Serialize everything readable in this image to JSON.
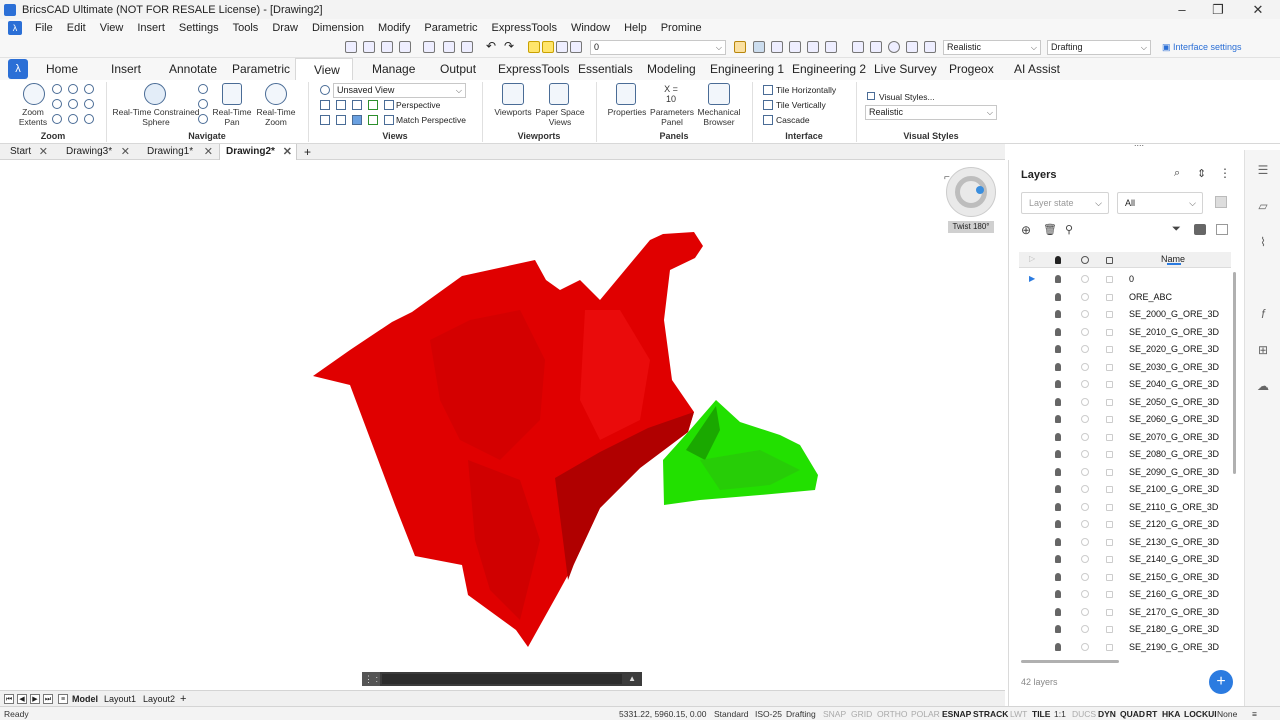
{
  "window": {
    "title": "BricsCAD Ultimate (NOT FOR RESALE License) - [Drawing2]"
  },
  "menu": [
    "File",
    "Edit",
    "View",
    "Insert",
    "Settings",
    "Tools",
    "Draw",
    "Dimension",
    "Modify",
    "Parametric",
    "ExpressTools",
    "Window",
    "Help",
    "Promine"
  ],
  "qat": {
    "layer_combo": "0",
    "visual_style": "Realistic",
    "workspace": "Drafting",
    "interface_settings": "Interface settings"
  },
  "ribbon_tabs": [
    "Home",
    "Insert",
    "Annotate",
    "Parametric",
    "View",
    "Manage",
    "Output",
    "ExpressTools",
    "Essentials",
    "Modeling",
    "Engineering 1",
    "Engineering 2",
    "Live Survey",
    "Progeox",
    "AI Assist"
  ],
  "ribbon": {
    "zoom": {
      "title": "Zoom",
      "zoom_extents": "Zoom Extents"
    },
    "navigate": {
      "title": "Navigate",
      "constrained_sphere": "Real-Time Constrained Sphere",
      "pan": "Real-Time Pan",
      "zoom": "Real-Time Zoom"
    },
    "views": {
      "title": "Views",
      "view_combo": "Unsaved View",
      "perspective": "Perspective",
      "match_perspective": "Match Perspective"
    },
    "viewports": {
      "title": "Viewports",
      "viewports": "Viewports",
      "paper_space": "Paper Space Views"
    },
    "panels": {
      "title": "Panels",
      "properties": "Properties",
      "parameters": "Parameters Panel",
      "mechanical": "Mechanical Browser",
      "param_glyph": "X = 10"
    },
    "interface": {
      "title": "Interface",
      "tile_h": "Tile Horizontally",
      "tile_v": "Tile Vertically",
      "cascade": "Cascade"
    },
    "visual_styles": {
      "title": "Visual Styles",
      "link": "Visual Styles...",
      "combo": "Realistic"
    }
  },
  "doc_tabs": [
    "Start",
    "Drawing3*",
    "Drawing1*",
    "Drawing2*"
  ],
  "viewport": {
    "twist": "Twist 180°",
    "colors": {
      "red_body": "#e00000",
      "red_dark": "#b00000",
      "green_body": "#22e000",
      "green_dark": "#1aa800"
    }
  },
  "layout_tabs": [
    "Model",
    "Layout1",
    "Layout2"
  ],
  "status": {
    "ready": "Ready",
    "coords": "5331.22, 5960.15, 0.00",
    "items": [
      {
        "label": "Standard",
        "state": "plain"
      },
      {
        "label": "ISO-25",
        "state": "plain"
      },
      {
        "label": "Drafting",
        "state": "plain"
      },
      {
        "label": "SNAP",
        "state": "off"
      },
      {
        "label": "GRID",
        "state": "off"
      },
      {
        "label": "ORTHO",
        "state": "off"
      },
      {
        "label": "POLAR",
        "state": "off"
      },
      {
        "label": "ESNAP",
        "state": "on"
      },
      {
        "label": "STRACK",
        "state": "on"
      },
      {
        "label": "LWT",
        "state": "off"
      },
      {
        "label": "TILE",
        "state": "on"
      },
      {
        "label": "1:1",
        "state": "plain"
      },
      {
        "label": "DUCS",
        "state": "off"
      },
      {
        "label": "DYN",
        "state": "on"
      },
      {
        "label": "QUAD",
        "state": "on"
      },
      {
        "label": "RT",
        "state": "on"
      },
      {
        "label": "HKA",
        "state": "on"
      },
      {
        "label": "LOCKUI",
        "state": "on"
      },
      {
        "label": "None",
        "state": "plain"
      }
    ]
  },
  "layers": {
    "title": "Layers",
    "layer_state_placeholder": "Layer state",
    "filter": "All",
    "name_header": "Name",
    "rows": [
      "0",
      "ORE_ABC",
      "SE_2000_G_ORE_3D",
      "SE_2010_G_ORE_3D",
      "SE_2020_G_ORE_3D",
      "SE_2030_G_ORE_3D",
      "SE_2040_G_ORE_3D",
      "SE_2050_G_ORE_3D",
      "SE_2060_G_ORE_3D",
      "SE_2070_G_ORE_3D",
      "SE_2080_G_ORE_3D",
      "SE_2090_G_ORE_3D",
      "SE_2100_G_ORE_3D",
      "SE_2110_G_ORE_3D",
      "SE_2120_G_ORE_3D",
      "SE_2130_G_ORE_3D",
      "SE_2140_G_ORE_3D",
      "SE_2150_G_ORE_3D",
      "SE_2160_G_ORE_3D",
      "SE_2170_G_ORE_3D",
      "SE_2180_G_ORE_3D",
      "SE_2190_G_ORE_3D"
    ],
    "count": "42 layers"
  }
}
